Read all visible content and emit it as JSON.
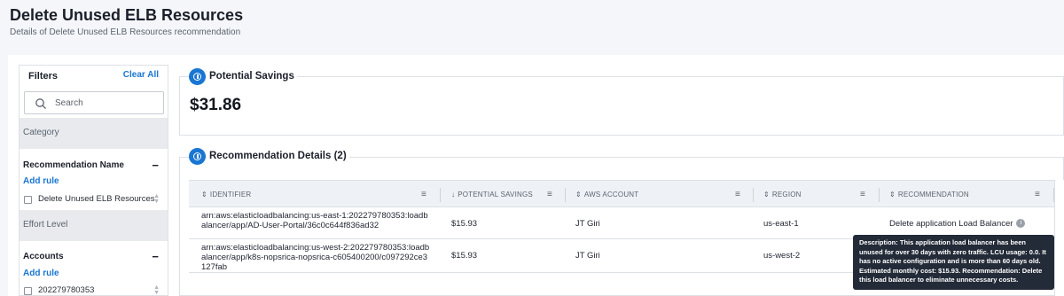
{
  "header": {
    "title": "Delete Unused ELB Resources",
    "subtitle": "Details of Delete Unused ELB Resources recommendation"
  },
  "filters": {
    "title": "Filters",
    "clear_all": "Clear All",
    "search_placeholder": "Search",
    "category_label": "Category",
    "recommendation_name": {
      "label": "Recommendation Name",
      "add_rule": "Add rule",
      "options": [
        "Delete Unused ELB Resources"
      ]
    },
    "effort_level_label": "Effort Level",
    "accounts": {
      "label": "Accounts",
      "add_rule": "Add rule",
      "options": [
        "202279780353"
      ]
    }
  },
  "savings_panel": {
    "title": "Potential Savings",
    "value": "$31.86"
  },
  "details_panel": {
    "title": "Recommendation Details (2)",
    "columns": [
      "IDENTIFIER",
      "POTENTIAL SAVINGS",
      "AWS ACCOUNT",
      "REGION",
      "RECOMMENDATION"
    ],
    "rows": [
      {
        "identifier": "arn:aws:elasticloadbalancing:us-east-1:202279780353:loadbalancer/app/AD-User-Portal/36c0c644f836ad32",
        "savings": "$15.93",
        "account": "JT Giri",
        "region": "us-east-1",
        "recommendation": "Delete application Load Balancer"
      },
      {
        "identifier": "arn:aws:elasticloadbalancing:us-west-2:202279780353:loadbalancer/app/k8s-nopsrica-nopsrica-c605400200/c097292ce3127fab",
        "savings": "$15.93",
        "account": "JT Giri",
        "region": "us-west-2",
        "recommendation": ""
      }
    ]
  },
  "tooltip": {
    "label": "Description:",
    "text": "This application load balancer has been unused for over 30 days with zero traffic. LCU usage: 0.0. It has no active configuration and is more than 60 days old. Estimated monthly cost: $15.93. Recommendation: Delete this load balancer to eliminate unnecessary costs."
  },
  "colors": {
    "accent": "#1976d2",
    "tooltip_bg": "#232b38",
    "band_bg": "#e8eaed"
  }
}
